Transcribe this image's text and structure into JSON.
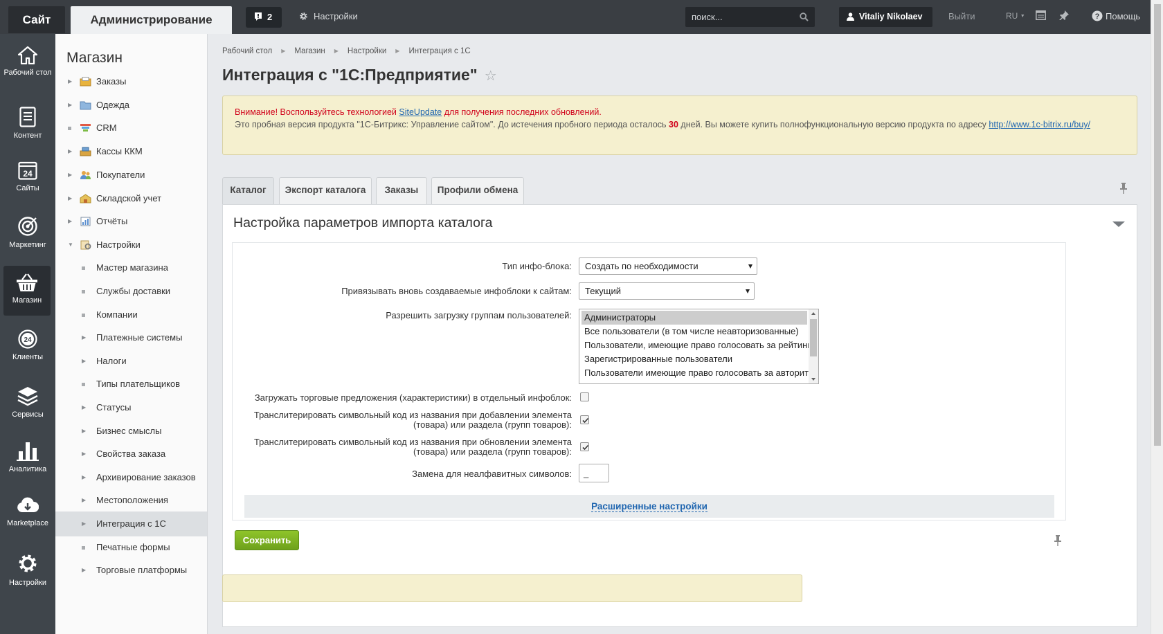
{
  "topbar": {
    "site_label": "Сайт",
    "admin_label": "Администрирование",
    "notify_count": "2",
    "settings_label": "Настройки",
    "search_placeholder": "поиск...",
    "user_name": "Vitaliy Nikolaev",
    "exit_label": "Выйти",
    "lang_label": "RU",
    "help_label": "Помощь"
  },
  "iconbar": [
    {
      "label": "Рабочий стол",
      "icon": "home-icon"
    },
    {
      "label": "Контент",
      "icon": "document-icon"
    },
    {
      "label": "Сайты",
      "icon": "calendar-24-icon"
    },
    {
      "label": "Маркетинг",
      "icon": "target-icon"
    },
    {
      "label": "Магазин",
      "icon": "basket-icon"
    },
    {
      "label": "Клиенты",
      "icon": "clients-24-icon"
    },
    {
      "label": "Сервисы",
      "icon": "layers-icon"
    },
    {
      "label": "Аналитика",
      "icon": "bar-chart-icon"
    },
    {
      "label": "Marketplace",
      "icon": "cloud-download-icon"
    },
    {
      "label": "Настройки",
      "icon": "gear-icon"
    }
  ],
  "menu": {
    "title": "Магазин",
    "items": [
      {
        "label": "Заказы"
      },
      {
        "label": "Одежда"
      },
      {
        "label": "CRM"
      },
      {
        "label": "Кассы ККМ"
      },
      {
        "label": "Покупатели"
      },
      {
        "label": "Складской учет"
      },
      {
        "label": "Отчёты"
      },
      {
        "label": "Настройки"
      },
      {
        "label": "Мастер магазина"
      },
      {
        "label": "Службы доставки"
      },
      {
        "label": "Компании"
      },
      {
        "label": "Платежные системы"
      },
      {
        "label": "Налоги"
      },
      {
        "label": "Типы плательщиков"
      },
      {
        "label": "Статусы"
      },
      {
        "label": "Бизнес смыслы"
      },
      {
        "label": "Свойства заказа"
      },
      {
        "label": "Архивирование заказов"
      },
      {
        "label": "Местоположения"
      },
      {
        "label": "Интеграция с 1С"
      },
      {
        "label": "Печатные формы"
      },
      {
        "label": "Торговые платформы"
      }
    ]
  },
  "breadcrumbs": [
    "Рабочий стол",
    "Магазин",
    "Настройки",
    "Интеграция с 1С"
  ],
  "page_title": "Интеграция с \"1С:Предприятие\"",
  "notice": {
    "line1_a": "Внимание! Воспользуйтесь технологией ",
    "line1_link": "SiteUpdate",
    "line1_b": " для получения последних обновлений.",
    "line2_a": "Это пробная версия продукта \"1С-Битрикс: Управление сайтом\". До истечения пробного периода осталось ",
    "days": "30",
    "line2_b": " дней. Вы можете купить полнофункциональную версию продукта по адресу ",
    "link2": "http://www.1c-bitrix.ru/buy/"
  },
  "tabs": [
    "Каталог",
    "Экспорт каталога",
    "Заказы",
    "Профили обмена"
  ],
  "panel": {
    "title": "Настройка параметров импорта каталога",
    "iblock_type_label": "Тип инфо-блока:",
    "iblock_type_value": "Создать по необходимости",
    "bind_sites_label": "Привязывать вновь создаваемые инфоблоки к сайтам:",
    "bind_sites_value": "Текущий",
    "groups_label": "Разрешить загрузку группам пользователей:",
    "groups": [
      "Администраторы",
      "Все пользователи (в том числе неавторизованные)",
      "Пользователи, имеющие право голосовать за рейтинг",
      "Зарегистрированные пользователи",
      "Пользователи имеющие право голосовать за авторитет"
    ],
    "offers_label": "Загружать торговые предложения (характеристики) в отдельный инфоблок:",
    "translit_add_label_1": "Транслитерировать символьный код из названия при добавлении элемента",
    "translit_add_label_2": "(товара) или раздела (групп товаров):",
    "translit_upd_label_1": "Транслитерировать символьный код из названия при обновлении элемента",
    "translit_upd_label_2": "(товара) или раздела (групп товаров):",
    "replace_label": "Замена для неалфавитных символов:",
    "replace_value": "_",
    "advanced_label": "Расширенные настройки",
    "save_label": "Сохранить"
  }
}
